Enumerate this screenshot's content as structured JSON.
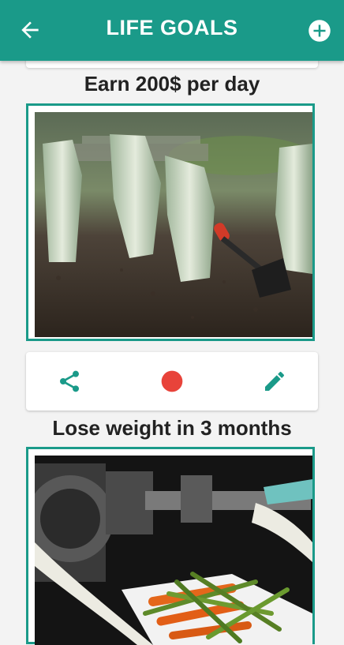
{
  "app": {
    "title": "LIFE GOALS",
    "accent_color": "#1a9a89",
    "status_dot_color": "#e8433a"
  },
  "toolbar": {
    "back_icon": "arrow-left-icon",
    "add_icon": "plus-circle-icon"
  },
  "goals": [
    {
      "title": "Earn 200$ per day",
      "image": "money-plants-in-soil-photo",
      "actions": [
        "share-icon",
        "status-dot-icon",
        "pencil-icon"
      ]
    },
    {
      "title": "Lose weight in 3 months",
      "image": "dumbbell-vegetables-tape-measure-photo"
    }
  ]
}
